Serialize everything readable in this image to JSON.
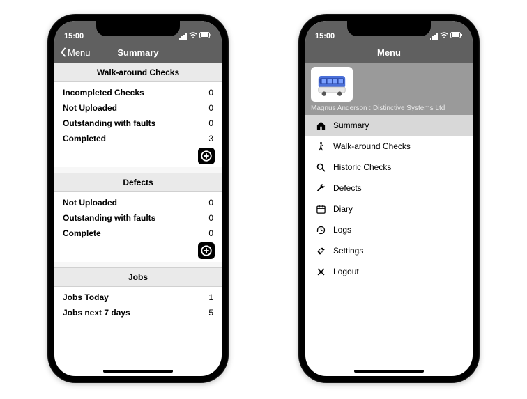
{
  "statusbar": {
    "time": "15:00"
  },
  "phone_summary": {
    "back_label": "Menu",
    "title": "Summary",
    "sections": {
      "walk": {
        "header": "Walk-around Checks",
        "rows": [
          {
            "label": "Incompleted Checks",
            "value": "0"
          },
          {
            "label": "Not Uploaded",
            "value": "0"
          },
          {
            "label": "Outstanding with faults",
            "value": "0"
          },
          {
            "label": "Completed",
            "value": "3"
          }
        ]
      },
      "defects": {
        "header": "Defects",
        "rows": [
          {
            "label": "Not Uploaded",
            "value": "0"
          },
          {
            "label": "Outstanding with faults",
            "value": "0"
          },
          {
            "label": "Complete",
            "value": "0"
          }
        ]
      },
      "jobs": {
        "header": "Jobs",
        "rows": [
          {
            "label": "Jobs Today",
            "value": "1"
          },
          {
            "label": "Jobs next 7 days",
            "value": "5"
          }
        ]
      }
    }
  },
  "phone_menu": {
    "title": "Menu",
    "user_caption": "Magnus Anderson : Distinctive Systems Ltd",
    "items": [
      {
        "label": "Summary",
        "icon": "home-icon",
        "selected": true
      },
      {
        "label": "Walk-around Checks",
        "icon": "walk-icon",
        "selected": false
      },
      {
        "label": "Historic Checks",
        "icon": "search-icon",
        "selected": false
      },
      {
        "label": "Defects",
        "icon": "wrench-icon",
        "selected": false
      },
      {
        "label": "Diary",
        "icon": "calendar-icon",
        "selected": false
      },
      {
        "label": "Logs",
        "icon": "history-icon",
        "selected": false
      },
      {
        "label": "Settings",
        "icon": "gear-icon",
        "selected": false
      },
      {
        "label": "Logout",
        "icon": "close-icon",
        "selected": false
      }
    ]
  }
}
